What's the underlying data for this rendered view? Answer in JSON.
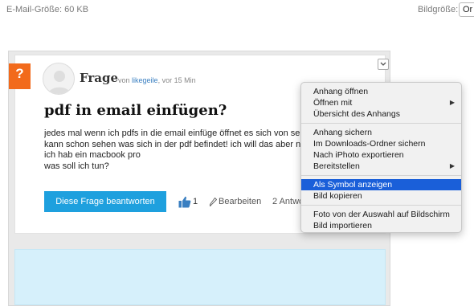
{
  "topbar": {
    "email_size": "E-Mail-Größe: 60 KB",
    "image_size_label": "Bildgröße:",
    "image_size_value": "Or"
  },
  "question": {
    "badge": "?",
    "type_label": "Frage",
    "meta_prefix": "von",
    "author": "likegeile",
    "meta_suffix": ", vor 15 Min",
    "title": "pdf in email einfügen?",
    "body_lines": [
      "jedes mal wenn ich pdfs in die email einfüge öffnet es sich von sell",
      "kann schon sehen was sich in der pdf befindet! ich will das aber ni",
      "ich hab ein macbook pro",
      "was soll ich tun?"
    ],
    "answer_button": "Diese Frage beantworten",
    "like_count": "1",
    "edit_label": "Bearbeiten",
    "answers_label": "2 Antwo"
  },
  "context_menu": {
    "items": [
      {
        "label": "Anhang öffnen",
        "submenu": false,
        "selected": false
      },
      {
        "label": "Öffnen mit",
        "submenu": true,
        "selected": false
      },
      {
        "label": "Übersicht des Anhangs",
        "submenu": false,
        "selected": false
      },
      {
        "label": "Anhang sichern",
        "submenu": false,
        "selected": false
      },
      {
        "label": "Im Downloads-Ordner sichern",
        "submenu": false,
        "selected": false
      },
      {
        "label": "Nach iPhoto exportieren",
        "submenu": false,
        "selected": false
      },
      {
        "label": "Bereitstellen",
        "submenu": true,
        "selected": false
      },
      {
        "label": "Als Symbol anzeigen",
        "submenu": false,
        "selected": true
      },
      {
        "label": "Bild kopieren",
        "submenu": false,
        "selected": false
      },
      {
        "label": "Foto von der Auswahl auf Bildschirm",
        "submenu": false,
        "selected": false
      },
      {
        "label": "Bild importieren",
        "submenu": false,
        "selected": false
      }
    ],
    "submenu_glyph": "▶"
  },
  "colors": {
    "badge": "#f26a1b",
    "answer_button": "#1ea0de",
    "menu_selected": "#1a5fd9",
    "author_link": "#3a7fc1"
  }
}
